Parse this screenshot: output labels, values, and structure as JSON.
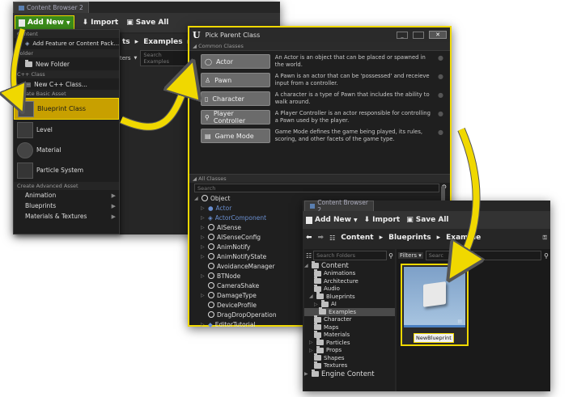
{
  "cb1": {
    "tab": "Content Browser 2",
    "add_new": "Add New",
    "import": "Import",
    "save_all": "Save All",
    "path": [
      "ts",
      "Examples"
    ],
    "filters": "lters",
    "search_placeholder": "Search Examples"
  },
  "menu": {
    "content_header": "Content",
    "add_feature": "Add Feature or Content Pack...",
    "folder_header": "Folder",
    "new_folder": "New Folder",
    "cpp_header": "C++ Class",
    "new_cpp": "New C++ Class...",
    "basic_header": "Create Basic Asset",
    "basic_items": [
      "Blueprint Class",
      "Level",
      "Material",
      "Particle System"
    ],
    "advanced_header": "Create Advanced Asset",
    "advanced_items": [
      "Animation",
      "Blueprints",
      "Materials & Textures"
    ]
  },
  "ppc": {
    "title": "Pick Parent Class",
    "common_header": "Common Classes",
    "common": [
      {
        "label": "Actor",
        "desc": "An Actor is an object that can be placed or spawned in the world."
      },
      {
        "label": "Pawn",
        "desc": "A Pawn is an actor that can be 'possessed' and receieve input from a controller."
      },
      {
        "label": "Character",
        "desc": "A character is a type of Pawn that includes the ability to walk around."
      },
      {
        "label": "Player Controller",
        "desc": "A Player Controller is an actor responsible for controlling a Pawn used by the player."
      },
      {
        "label": "Game Mode",
        "desc": "Game Mode defines the game being played, its rules, scoring, and other facets of the game type."
      }
    ],
    "all_header": "All Classes",
    "search_placeholder": "Search",
    "tree": [
      "Object",
      "Actor",
      "ActorComponent",
      "AISense",
      "AISenseConfig",
      "AnimNotify",
      "AnimNotifyState",
      "AvoidanceManager",
      "BTNode",
      "CameraShake",
      "DamageType",
      "DeviceProfile",
      "DragDropOperation",
      "EditorTutorial"
    ]
  },
  "cb2": {
    "tab": "Content Browser 2",
    "add_new": "Add New",
    "import": "Import",
    "save_all": "Save All",
    "path": [
      "Content",
      "Blueprints",
      "Example"
    ],
    "search_folders": "Search Folders",
    "filters": "Filters",
    "search_placeholder": "Searc",
    "folders": [
      "Content",
      "Animations",
      "Architecture",
      "Audio",
      "Blueprints",
      "AI",
      "Examples",
      "Character",
      "Maps",
      "Materials",
      "Particles",
      "Props",
      "Shapes",
      "Textures",
      "Engine Content"
    ],
    "asset_name": "NewBlueprint"
  },
  "colors": {
    "highlight": "#f0d800",
    "selected": "#c8a000",
    "accent": "#4a7fc0"
  }
}
